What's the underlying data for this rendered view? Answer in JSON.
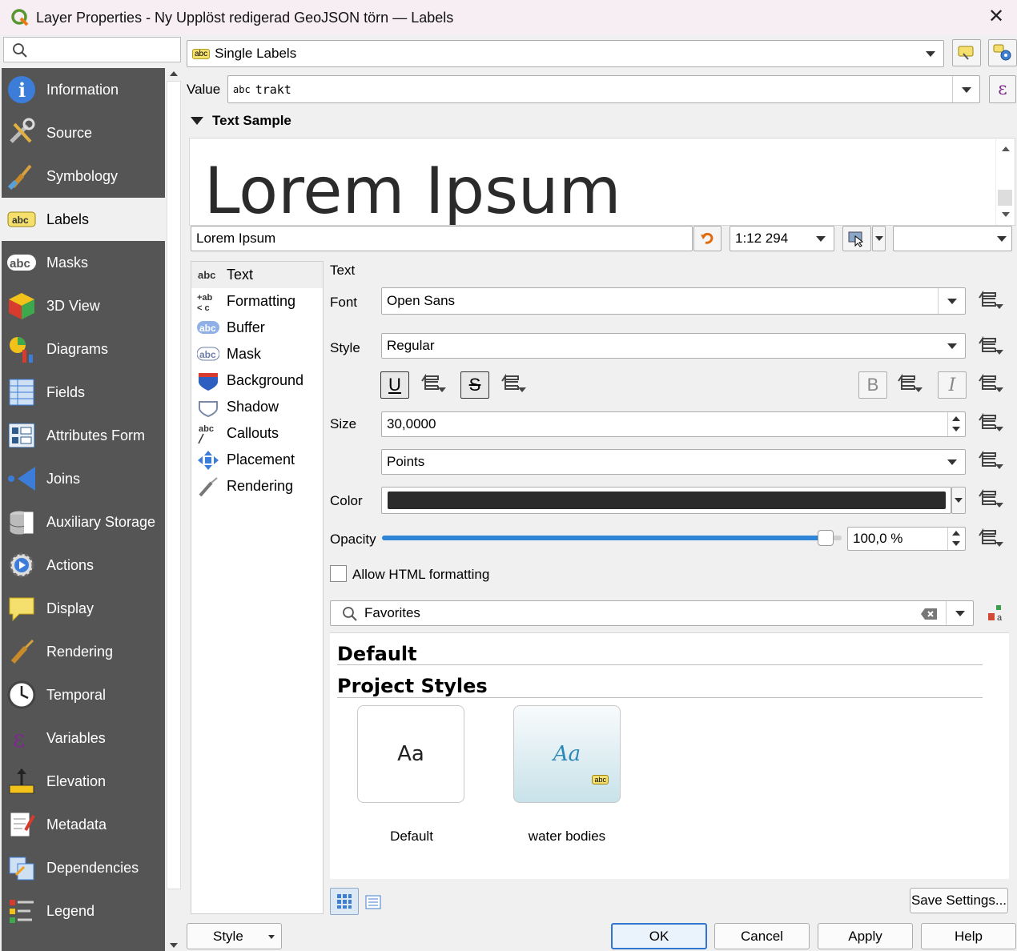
{
  "window": {
    "title": "Layer Properties - Ny Upplöst redigerad GeoJSON törn — Labels",
    "close_glyph": "✕"
  },
  "sidebar": {
    "search_placeholder": "",
    "items": [
      {
        "label": "Information",
        "icon": "info-icon"
      },
      {
        "label": "Source",
        "icon": "source-tools-icon"
      },
      {
        "label": "Symbology",
        "icon": "symbology-brush-icon"
      },
      {
        "label": "Labels",
        "icon": "labels-abc-icon",
        "selected": true
      },
      {
        "label": "Masks",
        "icon": "masks-abc-icon"
      },
      {
        "label": "3D View",
        "icon": "cube-3d-icon"
      },
      {
        "label": "Diagrams",
        "icon": "diagrams-icon"
      },
      {
        "label": "Fields",
        "icon": "fields-icon"
      },
      {
        "label": "Attributes Form",
        "icon": "attributes-form-icon"
      },
      {
        "label": "Joins",
        "icon": "joins-icon"
      },
      {
        "label": "Auxiliary Storage",
        "icon": "auxiliary-storage-icon"
      },
      {
        "label": "Actions",
        "icon": "actions-gear-icon"
      },
      {
        "label": "Display",
        "icon": "display-speech-icon"
      },
      {
        "label": "Rendering",
        "icon": "rendering-brush-icon"
      },
      {
        "label": "Temporal",
        "icon": "clock-icon"
      },
      {
        "label": "Variables",
        "icon": "epsilon-icon"
      },
      {
        "label": "Elevation",
        "icon": "elevation-icon"
      },
      {
        "label": "Metadata",
        "icon": "metadata-icon"
      },
      {
        "label": "Dependencies",
        "icon": "dependencies-icon"
      },
      {
        "label": "Legend",
        "icon": "legend-icon"
      }
    ]
  },
  "labeling_mode": {
    "value": "Single Labels",
    "badge": "abc"
  },
  "value_field": {
    "label": "Value",
    "badge": "abc",
    "expression": "trakt",
    "epsilon": "ε"
  },
  "text_sample": {
    "header": "Text Sample",
    "preview": "Lorem Ipsum",
    "input": "Lorem Ipsum",
    "scale": "1:12 294"
  },
  "subnav": [
    {
      "label": "Text",
      "icon": "abc-text-icon",
      "selected": true
    },
    {
      "label": "Formatting",
      "icon": "formatting-icon"
    },
    {
      "label": "Buffer",
      "icon": "buffer-icon"
    },
    {
      "label": "Mask",
      "icon": "mask-icon"
    },
    {
      "label": "Background",
      "icon": "background-shield-icon"
    },
    {
      "label": "Shadow",
      "icon": "shadow-icon"
    },
    {
      "label": "Callouts",
      "icon": "callouts-icon"
    },
    {
      "label": "Placement",
      "icon": "placement-icon"
    },
    {
      "label": "Rendering",
      "icon": "rendering-icon"
    }
  ],
  "text_panel": {
    "section": "Text",
    "font_label": "Font",
    "font": "Open Sans",
    "style_label": "Style",
    "style": "Regular",
    "underline": "U",
    "strike": "S",
    "bold": "B",
    "italic": "I",
    "size_label": "Size",
    "size": "30,0000",
    "unit": "Points",
    "color_label": "Color",
    "color": "#2b2b2b",
    "opacity_label": "Opacity",
    "opacity_percent": 100,
    "opacity_text": "100,0 %",
    "html_label": "Allow HTML formatting",
    "html_checked": false
  },
  "style_manager": {
    "search": "Favorites",
    "groups": [
      "Default",
      "Project Styles"
    ],
    "styles": [
      {
        "preview": "Aa",
        "name": "Default"
      },
      {
        "preview": "Aa",
        "badge": "abc",
        "name": "water bodies"
      }
    ],
    "save_button": "Save Settings..."
  },
  "footer": {
    "style": "Style",
    "ok": "OK",
    "cancel": "Cancel",
    "apply": "Apply",
    "help": "Help"
  },
  "colors": {
    "accent": "#2f77d0",
    "sidebar_bg": "#555555",
    "slider": "#2f84d8"
  }
}
